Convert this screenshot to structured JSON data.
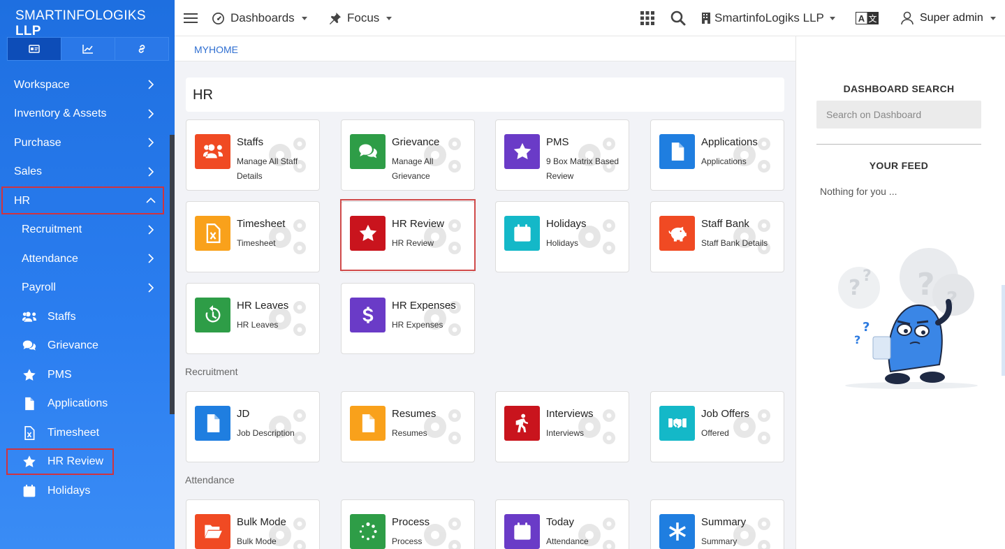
{
  "brand": {
    "name": "SMARTINFOLOGIKS",
    "suffix": "LLP"
  },
  "side_tabs": [
    {
      "icon": "id-card-icon",
      "active": true
    },
    {
      "icon": "chart-line-icon",
      "active": false
    },
    {
      "icon": "link-icon",
      "active": false
    }
  ],
  "sidebar": {
    "items": [
      {
        "label": "Workspace",
        "type": "group"
      },
      {
        "label": "Inventory & Assets",
        "type": "group"
      },
      {
        "label": "Purchase",
        "type": "group"
      },
      {
        "label": "Sales",
        "type": "group"
      },
      {
        "label": "HR",
        "type": "group-open"
      },
      {
        "label": "Recruitment",
        "type": "sub"
      },
      {
        "label": "Attendance",
        "type": "sub"
      },
      {
        "label": "Payroll",
        "type": "sub"
      },
      {
        "label": "Staffs",
        "type": "leaf",
        "icon": "users-icon"
      },
      {
        "label": "Grievance",
        "type": "leaf",
        "icon": "comments-icon"
      },
      {
        "label": "PMS",
        "type": "leaf",
        "icon": "star-icon"
      },
      {
        "label": "Applications",
        "type": "leaf",
        "icon": "file-icon"
      },
      {
        "label": "Timesheet",
        "type": "leaf",
        "icon": "file-excel-icon"
      },
      {
        "label": "HR Review",
        "type": "leaf",
        "icon": "star-icon"
      },
      {
        "label": "Holidays",
        "type": "leaf",
        "icon": "calendar-icon"
      }
    ]
  },
  "topbar": {
    "dashboards": "Dashboards",
    "focus": "Focus",
    "company": "SmartinfoLogiks LLP",
    "user": "Super admin",
    "icons": [
      "menu-icon",
      "gauge-icon",
      "pin-icon",
      "apps-grid-icon",
      "search-icon",
      "building-icon",
      "translate-icon",
      "user-icon"
    ]
  },
  "breadcrumb": "MYHOME",
  "main": {
    "title": "HR",
    "sections": [
      {
        "label": "",
        "cards": [
          {
            "title": "Staffs",
            "desc": "Manage All Staff Details",
            "color": "#f04a23",
            "icon": "users-icon"
          },
          {
            "title": "Grievance",
            "desc": "Manage All Grievance",
            "color": "#2e9d47",
            "icon": "comments-icon"
          },
          {
            "title": "PMS",
            "desc": "9 Box Matrix Based Review",
            "color": "#6a3bc7",
            "icon": "star-icon"
          },
          {
            "title": "Applications",
            "desc": "Applications",
            "color": "#1f7ee0",
            "icon": "file-icon"
          },
          {
            "title": "Timesheet",
            "desc": "Timesheet",
            "color": "#f9a11b",
            "icon": "file-excel-icon"
          },
          {
            "title": "HR Review",
            "desc": "HR Review",
            "color": "#c9141d",
            "icon": "star-icon"
          },
          {
            "title": "Holidays",
            "desc": "Holidays",
            "color": "#14b8c8",
            "icon": "calendar-icon"
          },
          {
            "title": "Staff Bank",
            "desc": "Staff Bank Details",
            "color": "#f04a23",
            "icon": "piggy-bank-icon"
          },
          {
            "title": "HR Leaves",
            "desc": "HR Leaves",
            "color": "#2e9d47",
            "icon": "history-icon"
          },
          {
            "title": "HR Expenses",
            "desc": "HR Expenses",
            "color": "#6a3bc7",
            "icon": "dollar-icon"
          }
        ]
      },
      {
        "label": "Recruitment",
        "cards": [
          {
            "title": "JD",
            "desc": "Job Description",
            "color": "#1f7ee0",
            "icon": "file-icon"
          },
          {
            "title": "Resumes",
            "desc": "Resumes",
            "color": "#f9a11b",
            "icon": "file-icon"
          },
          {
            "title": "Interviews",
            "desc": "Interviews",
            "color": "#c9141d",
            "icon": "walking-icon"
          },
          {
            "title": "Job Offers",
            "desc": "Offered",
            "color": "#14b8c8",
            "icon": "handshake-icon"
          }
        ]
      },
      {
        "label": "Attendance",
        "cards": [
          {
            "title": "Bulk Mode",
            "desc": "Bulk Mode",
            "color": "#f04a23",
            "icon": "folder-open-icon"
          },
          {
            "title": "Process",
            "desc": "Process",
            "color": "#2e9d47",
            "icon": "spinner-icon"
          },
          {
            "title": "Today",
            "desc": "Attendance",
            "color": "#6a3bc7",
            "icon": "calendar-icon"
          },
          {
            "title": "Summary",
            "desc": "Summary",
            "color": "#1f7ee0",
            "icon": "asterisk-icon"
          }
        ]
      }
    ]
  },
  "right_panel": {
    "search_title": "DASHBOARD SEARCH",
    "search_placeholder": "Search on Dashboard",
    "feed_title": "YOUR FEED",
    "feed_empty": "Nothing for you ..."
  }
}
